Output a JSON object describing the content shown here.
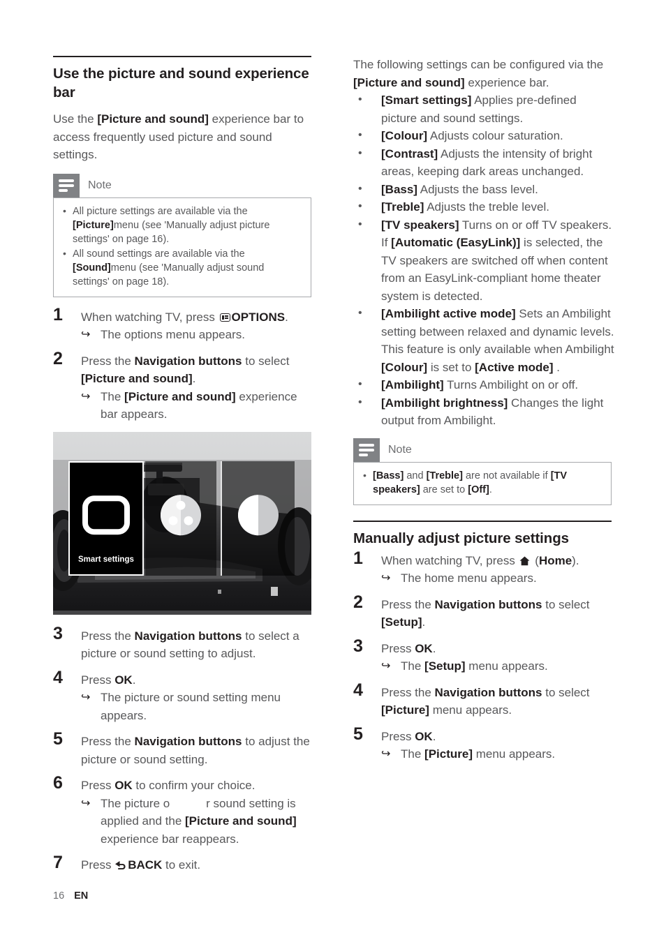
{
  "page": {
    "number": "16",
    "language": "EN"
  },
  "left": {
    "section_title": "Use the picture and sound experience bar",
    "intro_1": "Use the ",
    "intro_bold": "[Picture and sound]",
    "intro_2": " experience bar to access frequently used picture and sound settings.",
    "note": {
      "title": "Note",
      "icon": "note-lines-icon",
      "items": [
        {
          "pre": "All picture settings are available via the ",
          "bold": "[Picture]",
          "post": "menu (see 'Manually adjust picture settings' on page 16)."
        },
        {
          "pre": "All sound settings are available via the ",
          "bold": "[Sound]",
          "post": "menu (see 'Manually adjust sound settings' on page 18)."
        }
      ]
    },
    "steps": [
      {
        "num": "1",
        "text_pre": "When watching TV, press ",
        "icon": "options-icon",
        "text_bold": "OPTIONS",
        "text_post": ".",
        "result": "The options menu appears."
      },
      {
        "num": "2",
        "text_pre": "Press the ",
        "text_bold": "Navigation buttons",
        "text_mid": " to select ",
        "text_bold2": "[Picture and sound]",
        "text_post": ".",
        "result_pre": "The ",
        "result_bold": "[Picture and sound]",
        "result_post": " experience bar appears."
      },
      {
        "num": "3",
        "text_pre": "Press the ",
        "text_bold": "Navigation buttons",
        "text_post": " to select a picture or sound setting to adjust."
      },
      {
        "num": "4",
        "text_pre": "Press ",
        "text_bold": "OK",
        "text_post": ".",
        "result": "The picture or sound setting menu appears."
      },
      {
        "num": "5",
        "text_pre": "Press the ",
        "text_bold": "Navigation buttons",
        "text_post": " to adjust the picture or sound setting."
      },
      {
        "num": "6",
        "text_pre": "Press ",
        "text_bold": "OK",
        "text_post": " to confirm your choice.",
        "result_pre": "The picture o           r sound setting is applied and the ",
        "result_bold": "[Picture and sound]",
        "result_post": " experience bar reappears."
      },
      {
        "num": "7",
        "text_pre": "Press ",
        "icon": "back-arrow-icon",
        "text_bold": "BACK",
        "text_post": " to exit."
      }
    ],
    "figure": {
      "name": "picture-and-sound-experience-bar-screenshot",
      "panel_label": "Smart settings",
      "panels": [
        {
          "icon": "tv-screen-icon",
          "label": "Smart settings",
          "selected": true
        },
        {
          "icon": "colour-wheel-icon",
          "label": "",
          "selected": false
        },
        {
          "icon": "contrast-half-circle-icon",
          "label": "",
          "selected": false
        }
      ]
    }
  },
  "right": {
    "intro_pre": "The following settings can be configured via the ",
    "intro_bold": "[Picture and sound]",
    "intro_post": " experience bar.",
    "settings": [
      {
        "bold": "[Smart settings]",
        "text": " Applies pre-defined picture and sound settings."
      },
      {
        "bold": "[Colour]",
        "text": " Adjusts colour saturation."
      },
      {
        "bold": "[Contrast]",
        "text": " Adjusts the intensity of bright areas, keeping dark areas unchanged."
      },
      {
        "bold": "[Bass]",
        "text": " Adjusts the bass level."
      },
      {
        "bold": "[Treble]",
        "text": " Adjusts the treble level."
      },
      {
        "bold": "[TV speakers]",
        "text": " Turns on or off TV speakers. If ",
        "bold2": "[Automatic (EasyLink)]",
        "text2": "  is selected, the TV speakers are switched off when content from an EasyLink-compliant home theater system is detected."
      },
      {
        "bold": "[Ambilight active mode]",
        "text": " Sets an Ambilight setting between relaxed and dynamic levels. This feature is only available when Ambilight ",
        "bold2": "[Colour]",
        "text2": "  is set to ",
        "bold3": "[Active mode]",
        "text3": " ."
      },
      {
        "bold": "[Ambilight]",
        "text": " Turns Ambilight on or off."
      },
      {
        "bold": "[Ambilight brightness]",
        "text": " Changes the light output from Ambilight."
      }
    ],
    "note": {
      "title": "Note",
      "icon": "note-lines-icon",
      "item": {
        "b1": "[Bass]",
        "t1": " and ",
        "b2": "[Treble]",
        "t2": " are not available if ",
        "b3": "[TV speakers]",
        "t3": " are set to ",
        "b4": "[Off]",
        "t4": "."
      }
    },
    "section_title": "Manually adjust picture settings",
    "steps": [
      {
        "num": "1",
        "text_pre": "When watching TV, press ",
        "icon": "home-icon",
        "text_mid": " (",
        "text_bold": "Home",
        "text_post": ").",
        "result": "The home menu appears."
      },
      {
        "num": "2",
        "text_pre": "Press the ",
        "text_bold": "Navigation buttons",
        "text_mid": " to select ",
        "text_bold2": "[Setup]",
        "text_post": "."
      },
      {
        "num": "3",
        "text_pre": "Press ",
        "text_bold": "OK",
        "text_post": ".",
        "result_pre": "The ",
        "result_bold": "[Setup]",
        "result_post": " menu appears."
      },
      {
        "num": "4",
        "text_pre": "Press the ",
        "text_bold": "Navigation buttons",
        "text_mid": " to select ",
        "text_bold2": "[Picture]",
        "text_post": " menu appears."
      },
      {
        "num": "5",
        "text_pre": "Press ",
        "text_bold": "OK",
        "text_post": ".",
        "result_pre": "The ",
        "result_bold": "[Picture]",
        "result_post": " menu appears."
      }
    ]
  }
}
